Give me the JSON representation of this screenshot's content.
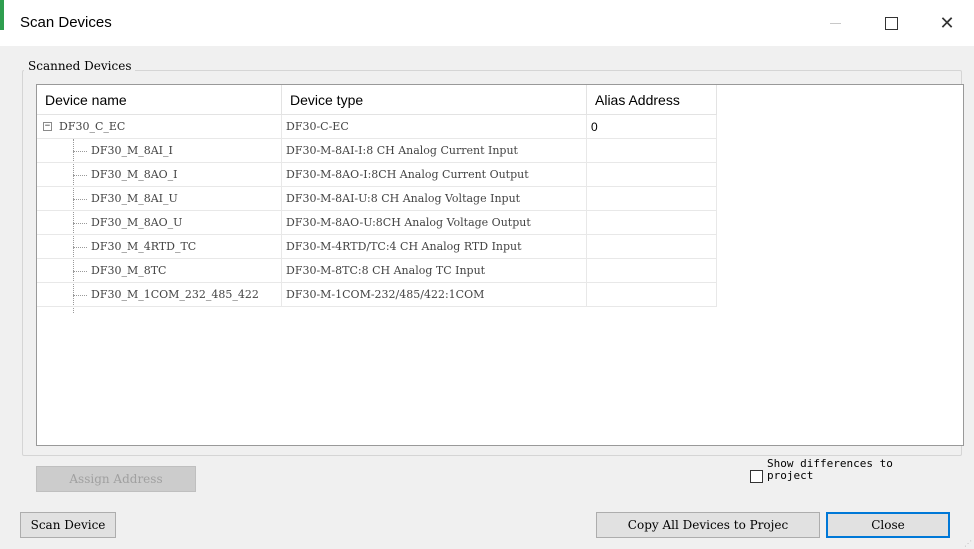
{
  "window": {
    "title": "Scan Devices",
    "minimize_icon": "minimize-icon",
    "maximize_icon": "maximize-icon",
    "close_glyph": "✕"
  },
  "group": {
    "legend": "Scanned Devices"
  },
  "table": {
    "columns": [
      "Device name",
      "Device type",
      "Alias Address"
    ],
    "root": {
      "name": "DF30_C_EC",
      "type": "DF30-C-EC",
      "alias": "0",
      "expander": "−"
    },
    "children": [
      {
        "name": "DF30_M_8AI_I",
        "type": "DF30-M-8AI-I:8 CH Analog Current Input",
        "alias": ""
      },
      {
        "name": "DF30_M_8AO_I",
        "type": "DF30-M-8AO-I:8CH Analog Current Output",
        "alias": ""
      },
      {
        "name": "DF30_M_8AI_U",
        "type": "DF30-M-8AI-U:8 CH Analog Voltage Input",
        "alias": ""
      },
      {
        "name": "DF30_M_8AO_U",
        "type": "DF30-M-8AO-U:8CH Analog Voltage Output",
        "alias": ""
      },
      {
        "name": "DF30_M_4RTD_TC",
        "type": "DF30-M-4RTD/TC:4 CH Analog RTD Input",
        "alias": ""
      },
      {
        "name": "DF30_M_8TC",
        "type": "DF30-M-8TC:8 CH Analog TC Input",
        "alias": ""
      },
      {
        "name": "DF30_M_1COM_232_485_422",
        "type": "DF30-M-1COM-232/485/422:1COM",
        "alias": ""
      }
    ]
  },
  "buttons": {
    "assign_address": "Assign Address",
    "scan_device": "Scan Device",
    "copy_all": "Copy All Devices to Projec",
    "close": "Close"
  },
  "checkbox": {
    "label": "Show differences to project",
    "checked": false
  },
  "colors": {
    "accent": "#2e9e4f",
    "default_button_border": "#0078d7"
  }
}
